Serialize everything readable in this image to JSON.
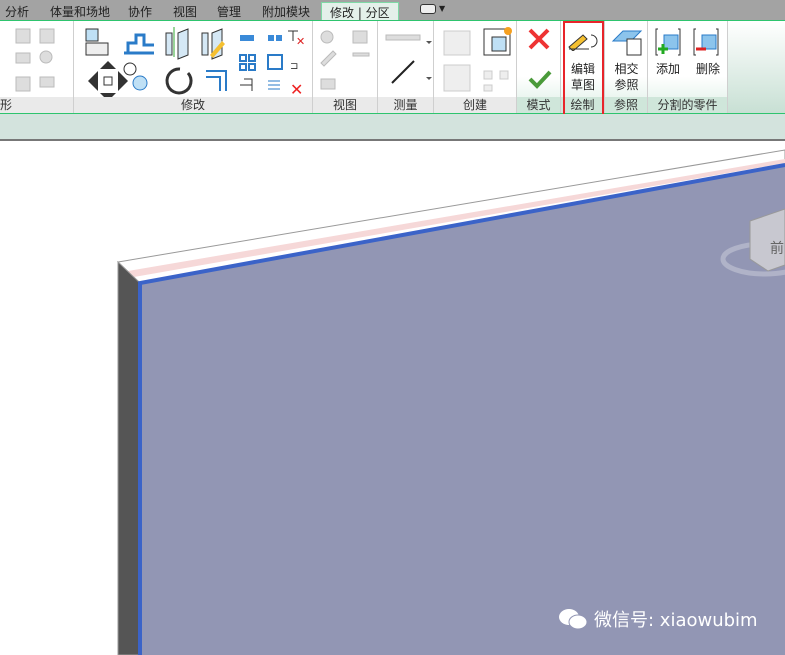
{
  "tabs": [
    "分析",
    "体量和场地",
    "协作",
    "视图",
    "管理",
    "附加模块",
    "修改 | 分区"
  ],
  "panels": {
    "geometry": "形",
    "modify": "修改",
    "view": "视图",
    "measure": "测量",
    "create": "创建",
    "mode": "模式",
    "draw": "绘制",
    "reference": "参照",
    "parts": "分割的零件"
  },
  "buttons": {
    "edit_sketch": [
      "编辑",
      "草图"
    ],
    "intersect_ref": [
      "相交",
      "参照"
    ],
    "add": "添加",
    "remove": "删除"
  },
  "viewcube": {
    "face": "前"
  },
  "watermark": "微信号: xiaowubim",
  "colors": {
    "accent": "#2ec46e",
    "wall_face": "#9296b4",
    "wall_edge": "#3b63c8",
    "highlight": "#e8242a"
  }
}
